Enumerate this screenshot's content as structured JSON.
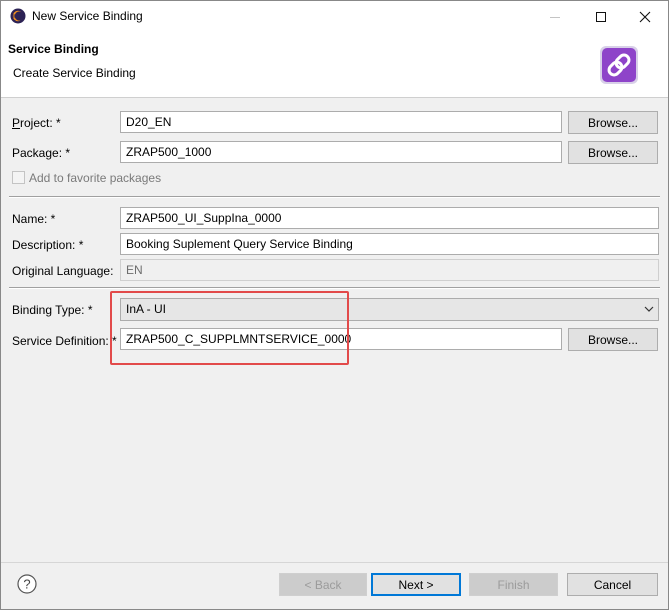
{
  "window": {
    "title": "New Service Binding",
    "icon": "eclipse-icon"
  },
  "header": {
    "title": "Service Binding",
    "subtitle": "Create Service Binding",
    "icon": "service-binding-wizard-icon",
    "icon_color": "#8e44c9"
  },
  "form": {
    "project": {
      "label": "Project: *",
      "value": "D20_EN",
      "browse": "Browse..."
    },
    "package": {
      "label": "Package: *",
      "value": "ZRAP500_1000",
      "browse": "Browse..."
    },
    "favorite": {
      "label": "Add to favorite packages",
      "checked": false
    },
    "name": {
      "label": "Name: *",
      "value": "ZRAP500_UI_SuppIna_0000"
    },
    "description": {
      "label": "Description: *",
      "value": "Booking Suplement Query Service Binding"
    },
    "original_language": {
      "label": "Original Language:",
      "value": "EN"
    },
    "binding_type": {
      "label": "Binding Type: *",
      "value": "InA - UI"
    },
    "service_definition": {
      "label": "Service Definition: *",
      "value": "ZRAP500_C_SUPPLMNTSERVICE_0000",
      "browse": "Browse..."
    }
  },
  "footer": {
    "back": "< Back",
    "next": "Next >",
    "finish": "Finish",
    "cancel": "Cancel"
  },
  "highlight_color": "#e24a4a"
}
